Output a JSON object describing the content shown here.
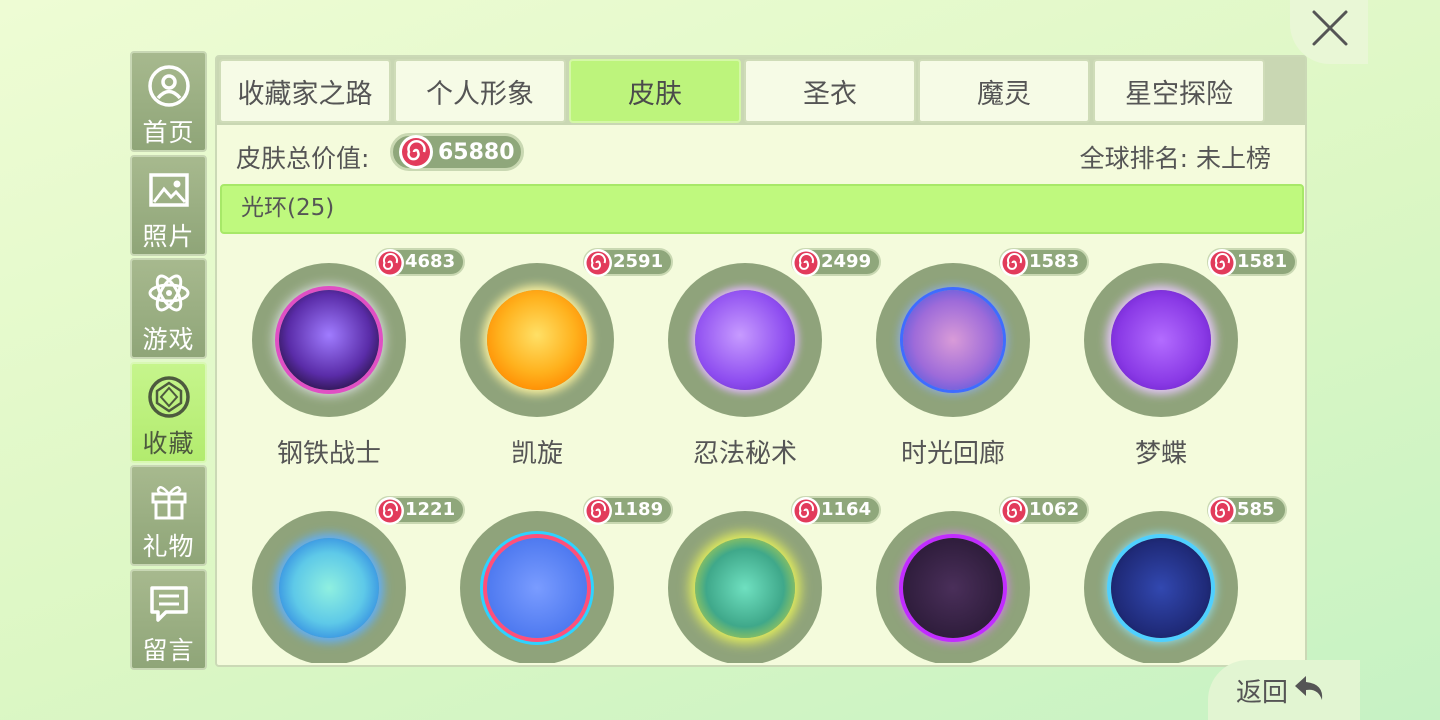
{
  "sidebar": {
    "items": [
      {
        "label": "首页",
        "icon": "user-circle-icon"
      },
      {
        "label": "照片",
        "icon": "photo-icon"
      },
      {
        "label": "游戏",
        "icon": "atom-icon"
      },
      {
        "label": "收藏",
        "icon": "gem-icon",
        "active": true
      },
      {
        "label": "礼物",
        "icon": "gift-icon"
      },
      {
        "label": "留言",
        "icon": "message-icon"
      }
    ]
  },
  "tabs": [
    {
      "label": "收藏家之路"
    },
    {
      "label": "个人形象"
    },
    {
      "label": "皮肤",
      "active": true
    },
    {
      "label": "圣衣"
    },
    {
      "label": "魔灵"
    },
    {
      "label": "星空探险"
    }
  ],
  "summary": {
    "value_label": "皮肤总价值:",
    "total_value": "65880",
    "rank_text": "全球排名: 未上榜"
  },
  "section": {
    "title": "光环(25)"
  },
  "items": [
    {
      "name": "钢铁战士",
      "price": "4683"
    },
    {
      "name": "凯旋",
      "price": "2591"
    },
    {
      "name": "忍法秘术",
      "price": "2499"
    },
    {
      "name": "时光回廊",
      "price": "1583"
    },
    {
      "name": "梦蝶",
      "price": "1581"
    },
    {
      "name": "",
      "price": "1221"
    },
    {
      "name": "",
      "price": "1189"
    },
    {
      "name": "",
      "price": "1164"
    },
    {
      "name": "",
      "price": "1062"
    },
    {
      "name": "",
      "price": "585"
    }
  ],
  "back": {
    "label": "返回",
    "icon": "return-arrow-icon"
  },
  "close": {
    "icon": "close-icon"
  },
  "colors": {
    "accent_green": "#bdf47c",
    "sidebar_grey_green": "#9cb083",
    "coin_red": "#e23b5b"
  }
}
